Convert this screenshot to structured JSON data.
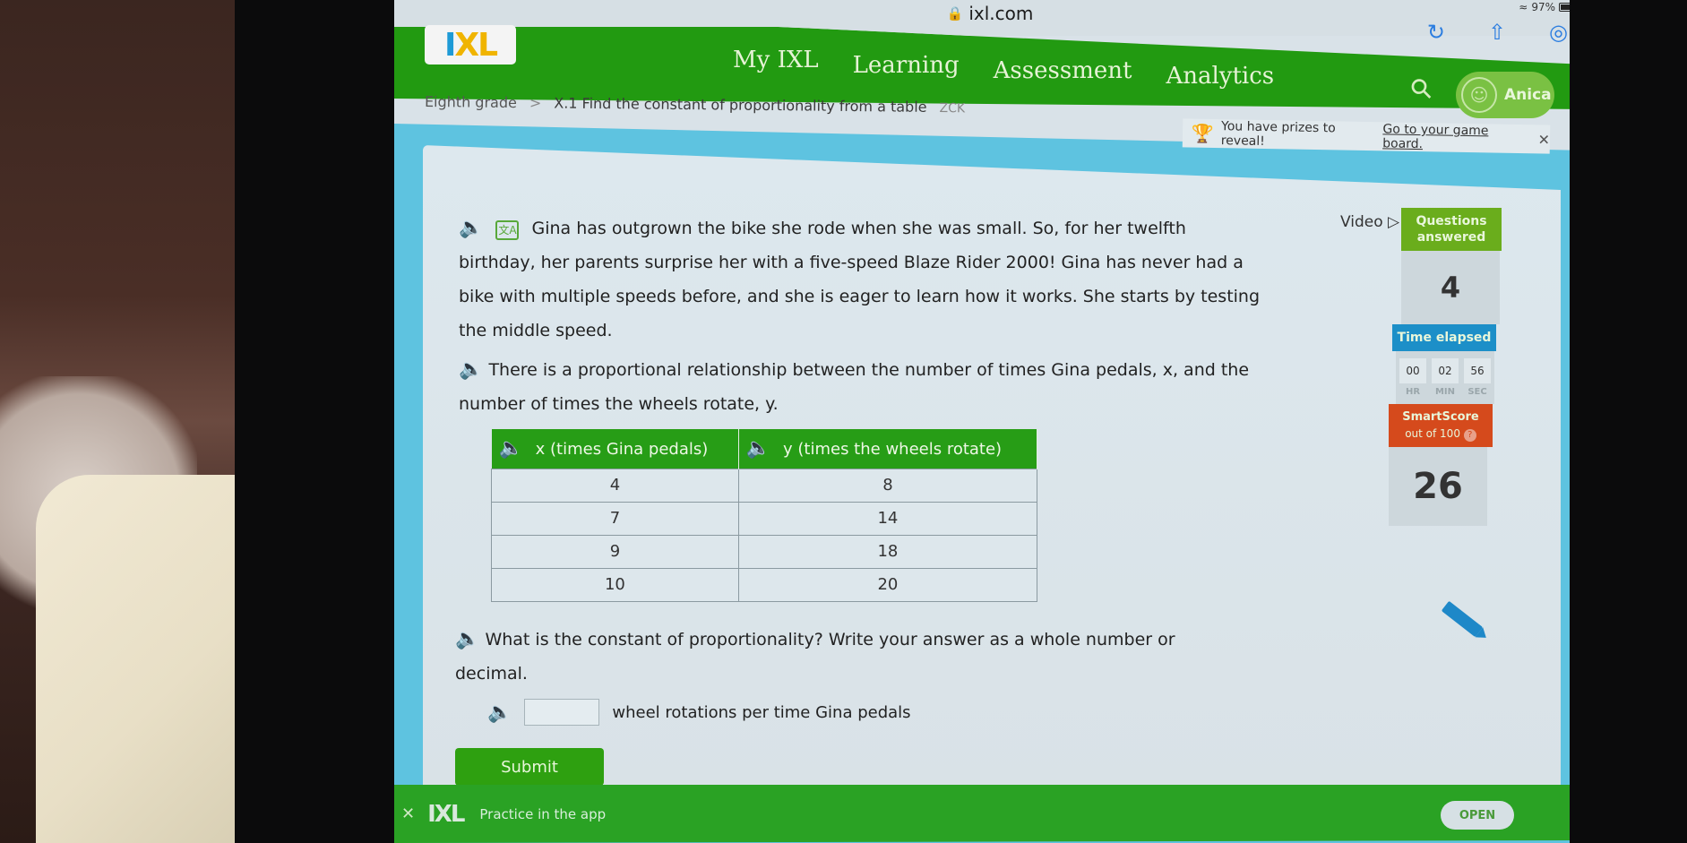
{
  "browser": {
    "url": "ixl.com",
    "battery": "97%",
    "icons": [
      "reload-icon",
      "share-icon",
      "compass-icon"
    ]
  },
  "header": {
    "logo": {
      "i": "I",
      "xl": "XL"
    },
    "nav": [
      "My IXL",
      "Learning",
      "Assessment",
      "Analytics"
    ],
    "active_nav": "Learning",
    "user_name": "Anica"
  },
  "breadcrumb": {
    "grade": "Eighth grade",
    "separator": ">",
    "skill": "X.1 Find the constant of proportionality from a table",
    "code": "ZCK"
  },
  "prize_banner": {
    "text": "You have prizes to reveal!",
    "link": "Go to your game board.",
    "close": "✕"
  },
  "question": {
    "intro": "Gina has outgrown the bike she rode when she was small. So, for her twelfth birthday, her parents surprise her with a five-speed Blaze Rider 2000! Gina has never had a bike with multiple speeds before, and she is eager to learn how it works. She starts by testing the middle speed.",
    "relationship": "There is a proportional relationship between the number of times Gina pedals, x, and the number of times the wheels rotate, y.",
    "table": {
      "headers": [
        "x (times Gina pedals)",
        "y (times the wheels rotate)"
      ],
      "rows": [
        [
          "4",
          "8"
        ],
        [
          "7",
          "14"
        ],
        [
          "9",
          "18"
        ],
        [
          "10",
          "20"
        ]
      ]
    },
    "prompt": "What is the constant of proportionality? Write your answer as a whole number or decimal.",
    "answer_value": "",
    "answer_suffix": "wheel rotations per time Gina pedals",
    "submit_label": "Submit",
    "translate_icon": "文A"
  },
  "sidebar": {
    "video_label": "Video",
    "questions_answered_label": "Questions answered",
    "questions_answered": "4",
    "time_label": "Time elapsed",
    "time": {
      "hr": "00",
      "min": "02",
      "sec": "56"
    },
    "time_units": {
      "hr": "HR",
      "min": "MIN",
      "sec": "SEC"
    },
    "smartscore_label": "SmartScore",
    "smartscore_sub": "out of 100",
    "smartscore": "26"
  },
  "app_banner": {
    "label": "Practice in the app",
    "open_label": "OPEN",
    "logo": "IXL"
  },
  "colors": {
    "brand_green": "#229a11",
    "accent_blue": "#1e88d6",
    "smartscore_red": "#d54a1c",
    "questions_green": "#6aad1c"
  }
}
